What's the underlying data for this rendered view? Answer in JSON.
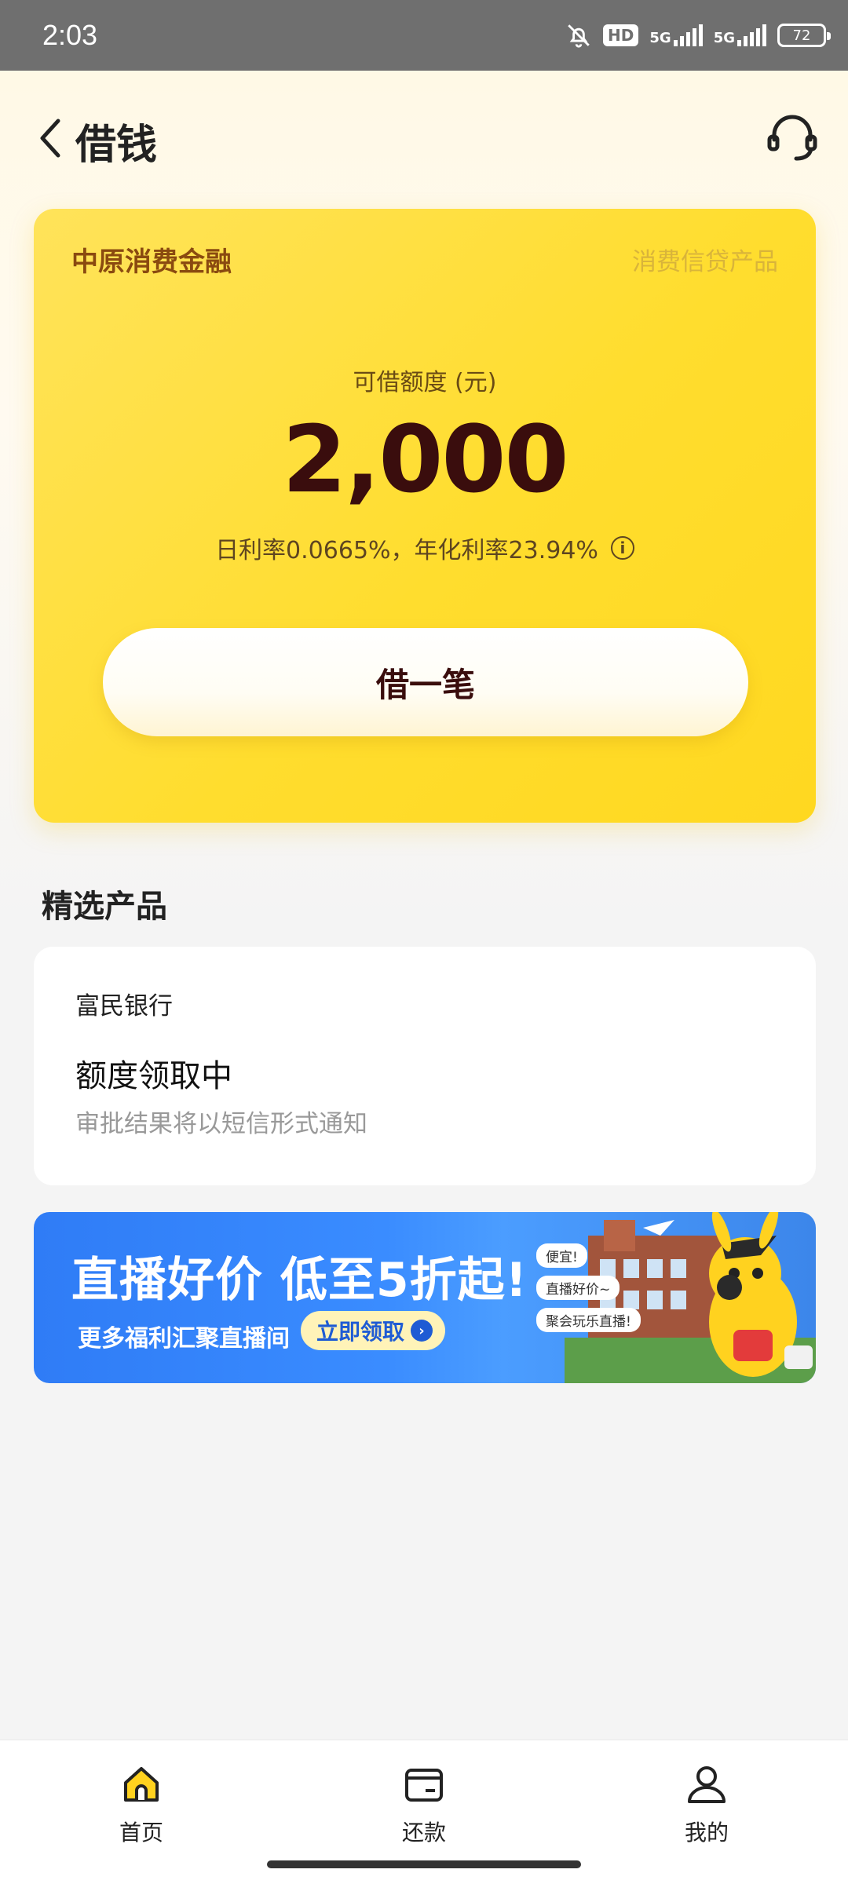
{
  "status_bar": {
    "time": "2:03",
    "hd_label": "HD",
    "network_1": "5G",
    "network_2": "5G",
    "battery": "72"
  },
  "header": {
    "title": "借钱"
  },
  "loan_card": {
    "brand": "中原消费金融",
    "tag": "消费信贷产品",
    "limit_label": "可借额度 (元)",
    "limit_amount": "2,000",
    "rate_text": "日利率0.0665%，年化利率23.94%",
    "borrow_button": "借一笔"
  },
  "section": {
    "title": "精选产品"
  },
  "product": {
    "bank": "富民银行",
    "status": "额度领取中",
    "note": "审批结果将以短信形式通知"
  },
  "banner": {
    "title": "直播好价 低至5折起!",
    "subtitle": "更多福利汇聚直播间",
    "cta": "立即领取",
    "bubbles": [
      "便宜!",
      "直播好价~",
      "聚会玩乐直播!"
    ]
  },
  "bottom_nav": {
    "items": [
      {
        "label": "首页",
        "icon": "home-icon"
      },
      {
        "label": "还款",
        "icon": "wallet-icon"
      },
      {
        "label": "我的",
        "icon": "user-icon"
      }
    ]
  },
  "colors": {
    "card_yellow": "#ffdd2e",
    "amount_dark": "#3a0d0d",
    "banner_blue": "#3a8cff"
  }
}
